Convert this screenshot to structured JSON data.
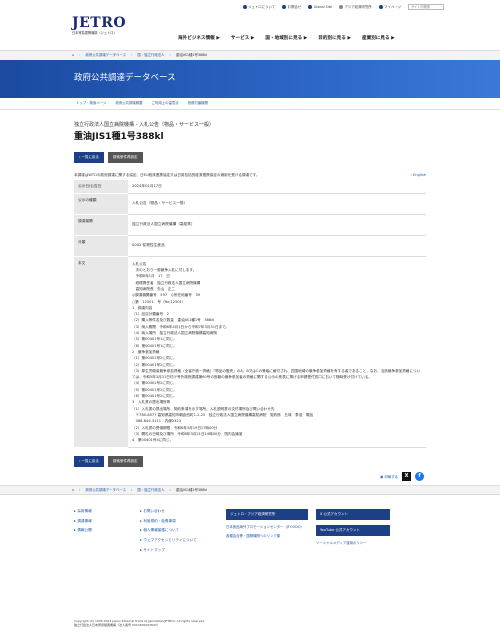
{
  "utility": {
    "about": "ジェトロについて",
    "contact": "お問合せ",
    "global": "Global Site",
    "asia": "アジア経済研究所",
    "mypage": "マイページ",
    "search_placeholder": "サイト内検索"
  },
  "logo": {
    "mark": "JETRO",
    "sub": "日本貿易振興機構（ジェトロ）"
  },
  "gnav": [
    "海外ビジネス情報 ▶",
    "サービス ▶",
    "国・地域別に見る ▶",
    "目的別に見る ▶",
    "産業別に見る ▶"
  ],
  "breadcrumb": [
    "政府公共調達データベース",
    "国・独立行政法人",
    "重油JIS1種1号388kl"
  ],
  "banner_title": "政府公共調達データベース",
  "subnav": [
    "トップ・検索ページ",
    "政府公共調達概要",
    "ご利用上の留意点",
    "役務付番機関"
  ],
  "kicker": "独立行政法人国立病院機構 - 入札公告（物品・サービス一般）",
  "title": "重油JIS1種1号388kl",
  "buttons": {
    "back": "一覧に戻る",
    "search": "検索条件再設定"
  },
  "note": "本調達はWTOの政府調達に関する協定、日EU経済連携協定又は日英包括的経済連携協定の適用を受ける調達です。",
  "english": "English",
  "table": {
    "pub_date_label": "公示日/公告日",
    "pub_date": "2024年01月17日",
    "type_label": "公示の種類",
    "type": "入札公告（物品・サービス一般）",
    "org_label": "調達機関",
    "org": "独立行政法人国立病院機構（高知県）",
    "cat_label": "分類",
    "cat": "0002 鉱物性生産品",
    "body_label": "本文",
    "body": "入札公告\n　次のとおり一般競争入札に付します。\n　令和6年1月　17　日\n　経理責任者　独立行政法人国立病院機構\n　高知病院長　先山　正二\n◎調達機関番号　597　◎所在地番号　39\n○第　12501　号（No.12501）\n1　調達内容\n（1）品目分類番号　2\n（2）購入等件名及び数量　重油JIS1種1号　388kl\n（3）納入期間　令和6年4月1日から令和7年3月31日まで。\n（4）納入場所　独立行政法人国立病院機構高知病院\n（5）第00401号1に同じ。\n（6）第00401号1に同じ。\n2　競争参加資格\n（1）第00401号2に同じ。\n（2）第00401号2に同じ。\n（3）厚生労働省競争参加資格（全省庁統一資格）「物品の販売」のA、B又はCの等級に格付され、四国地域の競争参加資格を有する者であること。なお、当該競争参加資格については、令和5年3月31日付け号外政府調達第60号の官報の競争参加者の資格に関する公示の別表に掲げる申請受付窓口において随時受け付けている。\n（4）第00401号2に同じ。\n（5）第00401号2に同じ。\n（6）第00401号2に同じ。\n3　入札書の提出場所等\n（1）入札書の提出場所、契約条項を示す場所、入札説明書の交付場所及び問い合わせ先\n　〒780-8077 高知県高知市朝倉西町1-2-25　独立行政法人国立病院機構高知病院　契約係　五味　泰浩　電話\n　088-844-3111　内線2323\n（2）入札書の受領期限　令和6年3月19日17時00分\n（3）開札の日時及び場所　令和6年3月21日14時00分　院内会議室\n4　第00401号4に同じ。"
  },
  "share": {
    "print": "印刷する"
  },
  "footer": {
    "col1": [
      "採用情報",
      "調達情報",
      "情報公開"
    ],
    "col2": [
      "お問い合わせ",
      "利用規約・免責事項",
      "個人情報保護について",
      "ウェブアクセシビリティについて",
      "サイトマップ"
    ],
    "col3": {
      "btn": "ジェトロ・アジア経済研究所",
      "links": [
        "日本食品海外プロモーションセンター（JFOODO）",
        "各種会合等・国際機関へのリンク集"
      ]
    },
    "col4": {
      "x": "X 公式アカウント",
      "yt": "YouTube 公式アカウント",
      "links": [
        "ソーシャルメディア運用ポリシー"
      ]
    }
  },
  "copyright": "Copyright (C) 1995-2024 Japan External Trade Organization(JETRO). All rights reserved.",
  "copyright2": "独立行政法人日本貿易振興機構（法人番号 2010405003693）",
  "colors": {
    "brand_blue": "#1d3f86",
    "link_blue": "#1a57a8"
  }
}
